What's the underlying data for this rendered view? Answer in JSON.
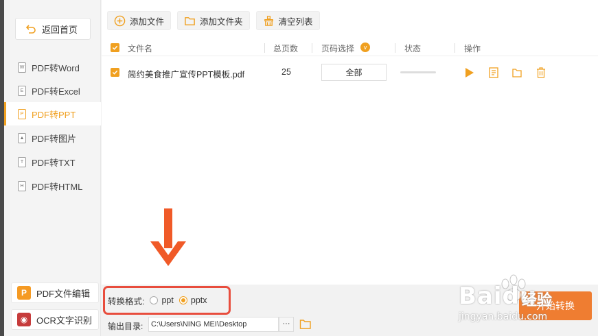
{
  "sidebar": {
    "back_label": "返回首页",
    "items": [
      {
        "label": "PDF转Word",
        "icon": "W"
      },
      {
        "label": "PDF转Excel",
        "icon": "E"
      },
      {
        "label": "PDF转PPT",
        "icon": "P",
        "active": true
      },
      {
        "label": "PDF转图片",
        "icon": "img"
      },
      {
        "label": "PDF转TXT",
        "icon": "T"
      },
      {
        "label": "PDF转HTML",
        "icon": "H"
      }
    ],
    "tools": [
      {
        "label": "PDF文件编辑",
        "icon_color": "#f59a23"
      },
      {
        "label": "OCR文字识别",
        "icon_color": "#c63b3b"
      }
    ]
  },
  "toolbar": {
    "add_file": "添加文件",
    "add_folder": "添加文件夹",
    "clear_list": "清空列表"
  },
  "table": {
    "headers": {
      "name": "文件名",
      "pages": "总页数",
      "range": "页码选择",
      "status": "状态",
      "actions": "操作"
    },
    "rows": [
      {
        "name": "简约美食推广宣传PPT模板.pdf",
        "pages": "25",
        "range": "全部",
        "status_progress": 0
      }
    ]
  },
  "bottom": {
    "format_label": "转换格式:",
    "options": [
      "ppt",
      "pptx"
    ],
    "selected": "pptx",
    "output_label": "输出目录:",
    "output_path": "C:\\Users\\NING MEI\\Desktop",
    "more_label": "···",
    "start_label": "开始转换"
  },
  "watermark": {
    "brand": "Baidu",
    "word": "经验",
    "url": "jingyan.baidu.com"
  },
  "colors": {
    "accent": "#f0a020",
    "highlight_red": "#e84d3d",
    "start": "#ef7d31"
  }
}
